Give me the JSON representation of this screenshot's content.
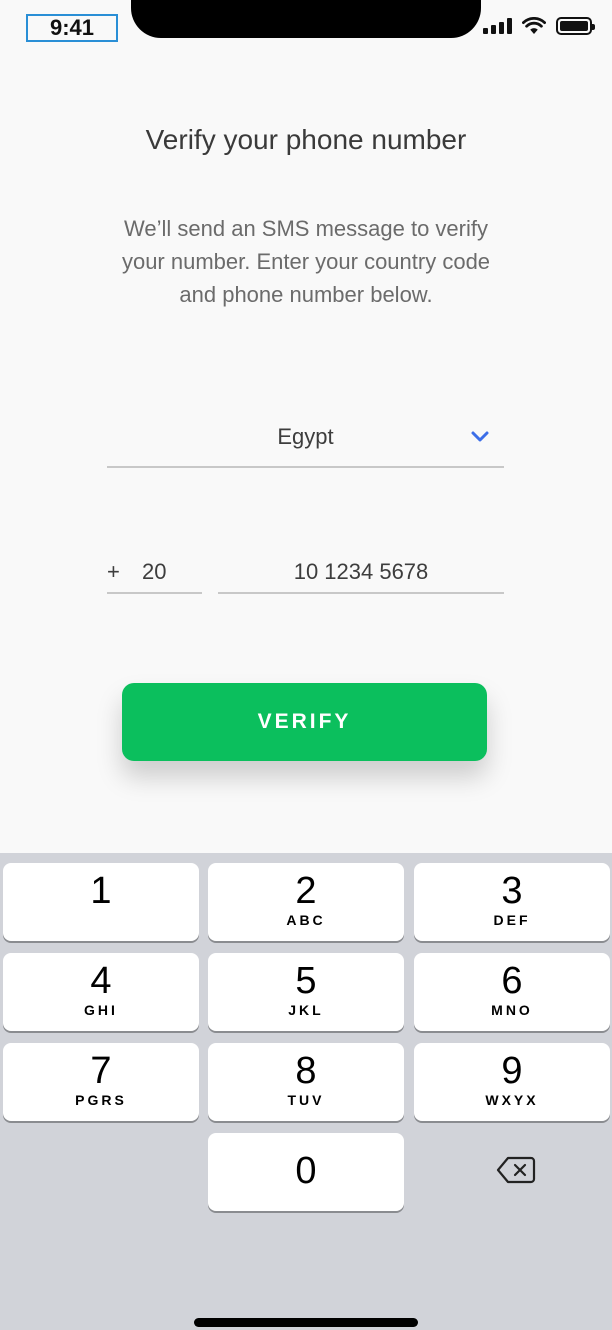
{
  "status_bar": {
    "time": "9:41"
  },
  "screen": {
    "title": "Verify your phone number",
    "subtitle": "We’ll send an SMS message to verify your number. Enter your country code and phone number below."
  },
  "form": {
    "country": "Egypt",
    "code_prefix": "+",
    "country_code": "20",
    "phone_number": "10 1234 5678",
    "verify_label": "VERIFY"
  },
  "colors": {
    "accent_green": "#0bbf5d",
    "chevron_blue": "#3c6ee8"
  },
  "keypad": {
    "keys": [
      {
        "digit": "1",
        "letters": ""
      },
      {
        "digit": "2",
        "letters": "ABC"
      },
      {
        "digit": "3",
        "letters": "DEF"
      },
      {
        "digit": "4",
        "letters": "GHI"
      },
      {
        "digit": "5",
        "letters": "JKL"
      },
      {
        "digit": "6",
        "letters": "MNO"
      },
      {
        "digit": "7",
        "letters": "PGRS"
      },
      {
        "digit": "8",
        "letters": "TUV"
      },
      {
        "digit": "9",
        "letters": "WXYX"
      },
      {
        "digit": "0",
        "letters": ""
      }
    ],
    "delete_icon": "backspace-icon"
  }
}
